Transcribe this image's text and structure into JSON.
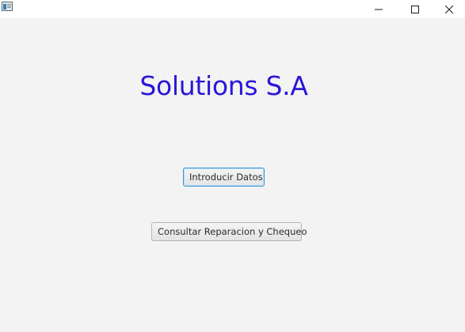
{
  "titlebar": {
    "app_icon": "app-window-icon",
    "controls": {
      "minimize_icon": "minimize-icon",
      "maximize_icon": "maximize-icon",
      "close_icon": "close-icon"
    }
  },
  "main": {
    "title": "Solutions S.A",
    "introducir_label": "Introducir Datos",
    "consultar_label": "Consultar Reparacion y Chequeo"
  },
  "colors": {
    "title": "#2a16d8",
    "background": "#f3f3f3",
    "focus_border": "#3296d6"
  }
}
